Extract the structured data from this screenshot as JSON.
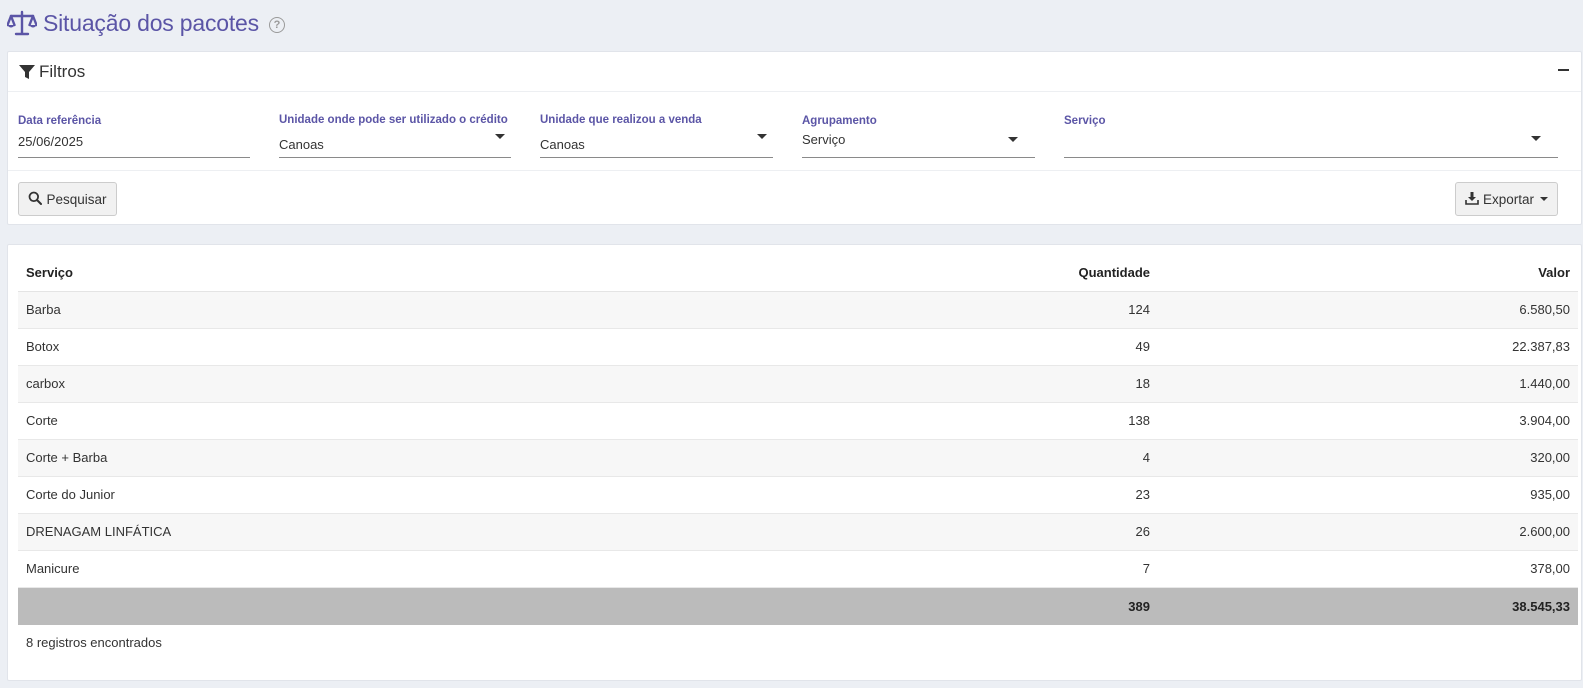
{
  "header": {
    "title": "Situação dos pacotes",
    "help": "?"
  },
  "filters": {
    "title": "Filtros",
    "fields": [
      {
        "label": "Data referência",
        "value": "25/06/2025"
      },
      {
        "label": "Unidade onde pode ser utilizado o crédito",
        "value": "Canoas"
      },
      {
        "label": "Unidade que realizou a venda",
        "value": "Canoas"
      },
      {
        "label": "Agrupamento",
        "value": "Serviço"
      },
      {
        "label": "Serviço",
        "value": ""
      }
    ],
    "search_label": "Pesquisar",
    "export_label": "Exportar"
  },
  "table": {
    "columns": [
      "Serviço",
      "Quantidade",
      "Valor"
    ],
    "rows": [
      {
        "service": "Barba",
        "qty": "124",
        "value": "6.580,50"
      },
      {
        "service": "Botox",
        "qty": "49",
        "value": "22.387,83"
      },
      {
        "service": "carbox",
        "qty": "18",
        "value": "1.440,00"
      },
      {
        "service": "Corte",
        "qty": "138",
        "value": "3.904,00"
      },
      {
        "service": "Corte + Barba",
        "qty": "4",
        "value": "320,00"
      },
      {
        "service": "Corte do Junior",
        "qty": "23",
        "value": "935,00"
      },
      {
        "service": "DRENAGAM LINFÁTICA",
        "qty": "26",
        "value": "2.600,00"
      },
      {
        "service": "Manicure",
        "qty": "7",
        "value": "378,00"
      }
    ],
    "totals": {
      "qty": "389",
      "value": "38.545,33"
    },
    "records_text": "8 registros encontrados"
  },
  "colors": {
    "accent": "#5b55a6",
    "background": "#eceff4",
    "total_row": "#bbbbbb"
  }
}
